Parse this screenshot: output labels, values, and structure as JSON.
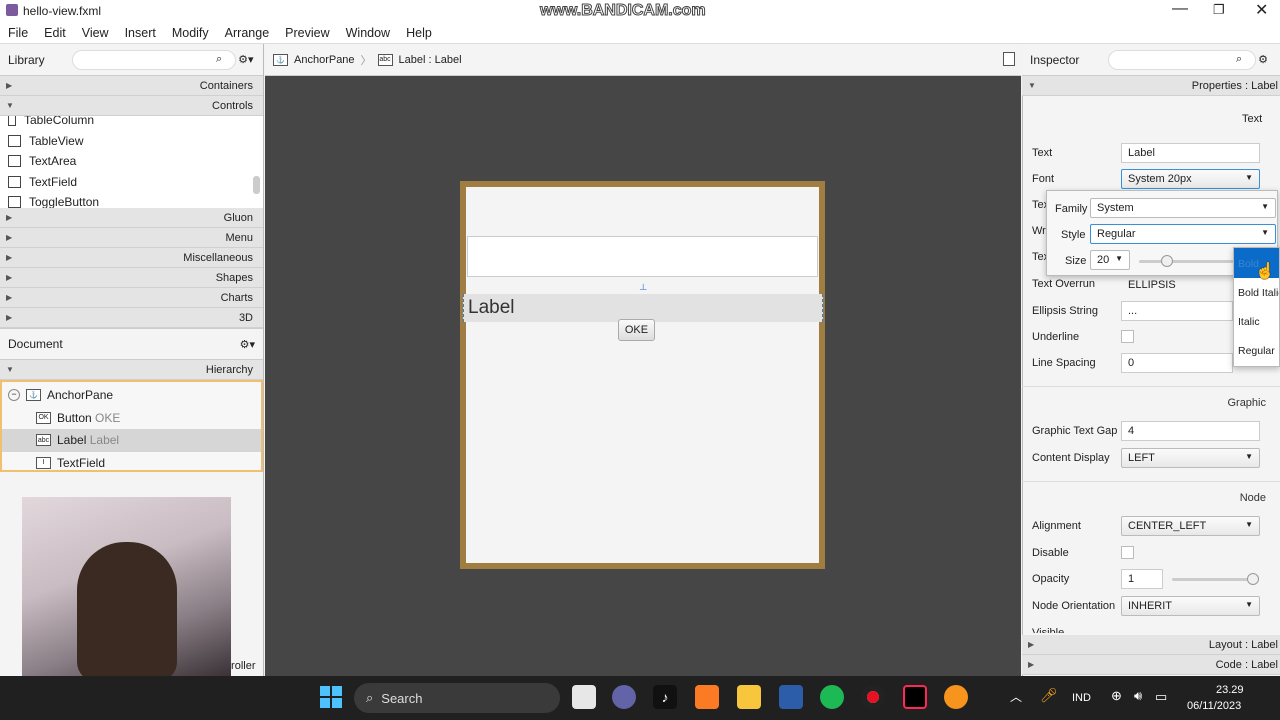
{
  "window": {
    "title": "hello-view.fxml",
    "watermark": "www.BANDICAM.com"
  },
  "menu": [
    "File",
    "Edit",
    "View",
    "Insert",
    "Modify",
    "Arrange",
    "Preview",
    "Window",
    "Help"
  ],
  "library": {
    "title": "Library",
    "sections_top": [
      "Containers",
      "Controls"
    ],
    "items": [
      "TableColumn",
      "TableView",
      "TextArea",
      "TextField",
      "ToggleButton"
    ],
    "sections_bottom": [
      "Gluon",
      "Menu",
      "Miscellaneous",
      "Shapes",
      "Charts",
      "3D"
    ]
  },
  "document": {
    "title": "Document",
    "hierarchy_label": "Hierarchy",
    "root": "AnchorPane",
    "children": [
      {
        "name": "Button",
        "value": "OKE",
        "icon": "OK"
      },
      {
        "name": "Label",
        "value": "Label",
        "icon": "abc"
      },
      {
        "name": "TextField",
        "value": "",
        "icon": "I"
      }
    ],
    "controller_partial": "troller"
  },
  "breadcrumb": [
    "AnchorPane",
    "Label : Label"
  ],
  "design": {
    "label_text": "Label",
    "button_text": "OKE"
  },
  "inspector": {
    "title": "Inspector",
    "properties_header": "Properties : Label",
    "section_text": "Text",
    "text_label": "Text",
    "text_value": "Label",
    "font_label": "Font",
    "font_value": "System 20px",
    "row_partials": [
      "Tex",
      "Wr",
      "Tex"
    ],
    "overrun_label": "Text Overrun",
    "overrun_value": "ELLIPSIS",
    "ellipsis_label": "Ellipsis String",
    "ellipsis_value": "...",
    "underline_label": "Underline",
    "line_spacing_label": "Line Spacing",
    "line_spacing_value": "0",
    "section_graphic": "Graphic",
    "gap_label": "Graphic Text Gap",
    "gap_value": "4",
    "content_display_label": "Content Display",
    "content_display_value": "LEFT",
    "section_node": "Node",
    "alignment_label": "Alignment",
    "alignment_value": "CENTER_LEFT",
    "disable_label": "Disable",
    "opacity_label": "Opacity",
    "opacity_value": "1",
    "orientation_label": "Node Orientation",
    "orientation_value": "INHERIT",
    "visible_label": "Visible",
    "layout_footer": "Layout : Label",
    "code_footer": "Code : Label"
  },
  "font_popup": {
    "family_label": "Family",
    "family_value": "System",
    "style_label": "Style",
    "style_value": "Regular",
    "size_label": "Size",
    "size_value": "20",
    "slider_level": 0.25
  },
  "style_dropdown": [
    "Bold",
    "Bold Italic",
    "Italic",
    "Regular"
  ],
  "opacity_level": 1.0,
  "taskbar": {
    "search_placeholder": "Search",
    "lang": "IND",
    "time": "23.29",
    "date": "06/11/2023"
  }
}
